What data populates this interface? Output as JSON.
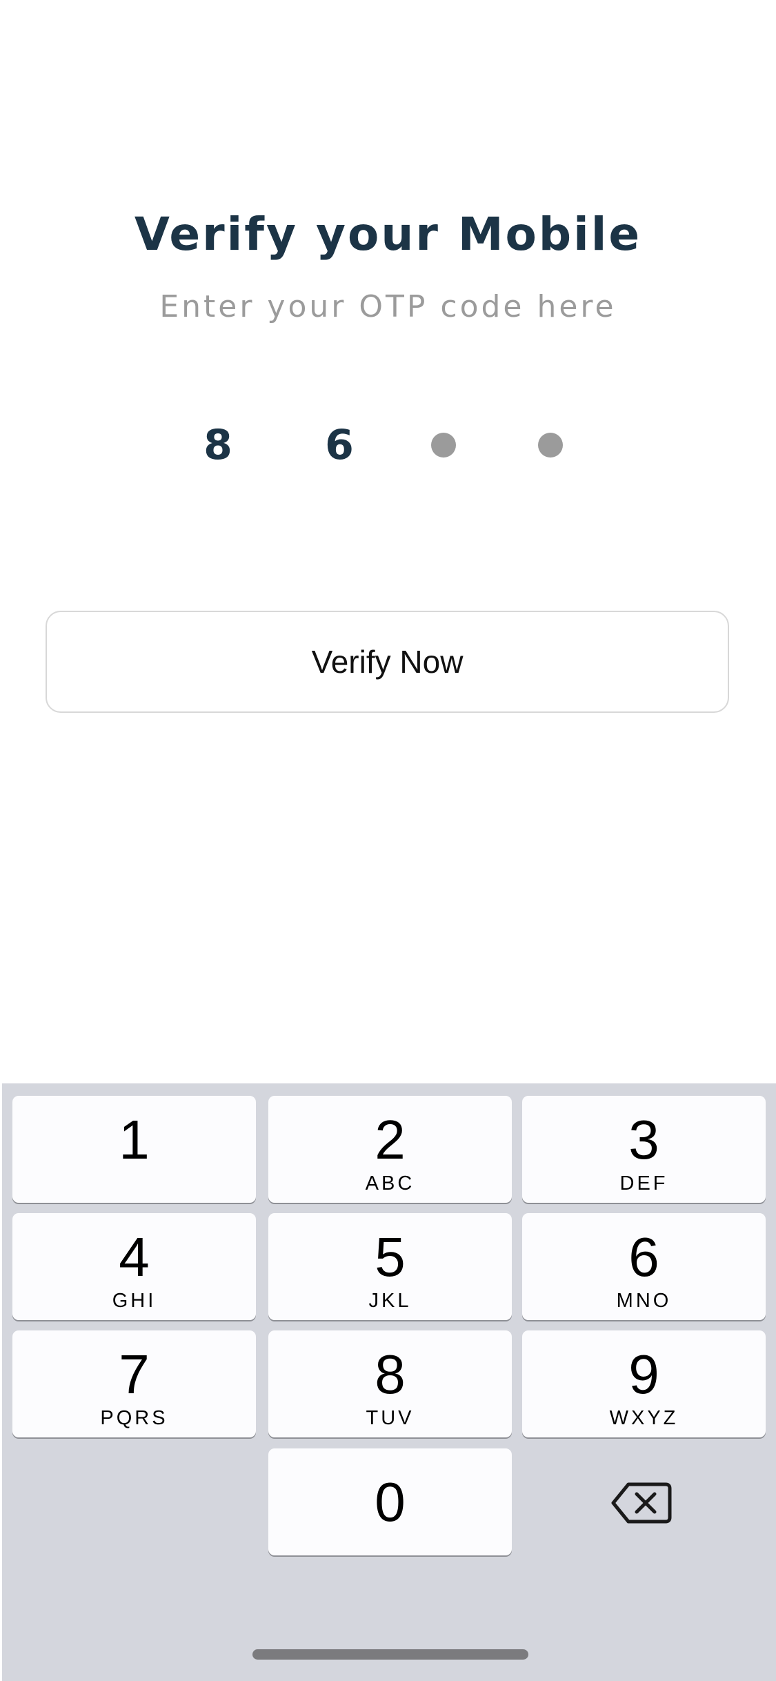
{
  "header": {
    "title": "Verify your Mobile",
    "subtitle": "Enter your OTP code here"
  },
  "otp": {
    "digits": [
      "8",
      "6"
    ],
    "remaining_slots": 2
  },
  "actions": {
    "verify_label": "Verify Now"
  },
  "keyboard": {
    "keys": [
      {
        "number": "1",
        "letters": ""
      },
      {
        "number": "2",
        "letters": "ABC"
      },
      {
        "number": "3",
        "letters": "DEF"
      },
      {
        "number": "4",
        "letters": "GHI"
      },
      {
        "number": "5",
        "letters": "JKL"
      },
      {
        "number": "6",
        "letters": "MNO"
      },
      {
        "number": "7",
        "letters": "PQRS"
      },
      {
        "number": "8",
        "letters": "TUV"
      },
      {
        "number": "9",
        "letters": "WXYZ"
      },
      {
        "number": "0",
        "letters": ""
      }
    ],
    "delete_icon": "backspace-icon"
  },
  "colors": {
    "title": "#1c3446",
    "subtitle": "#9b9b9b",
    "keyboard_bg": "#d4d6dd",
    "key_bg": "#fcfcfe"
  }
}
